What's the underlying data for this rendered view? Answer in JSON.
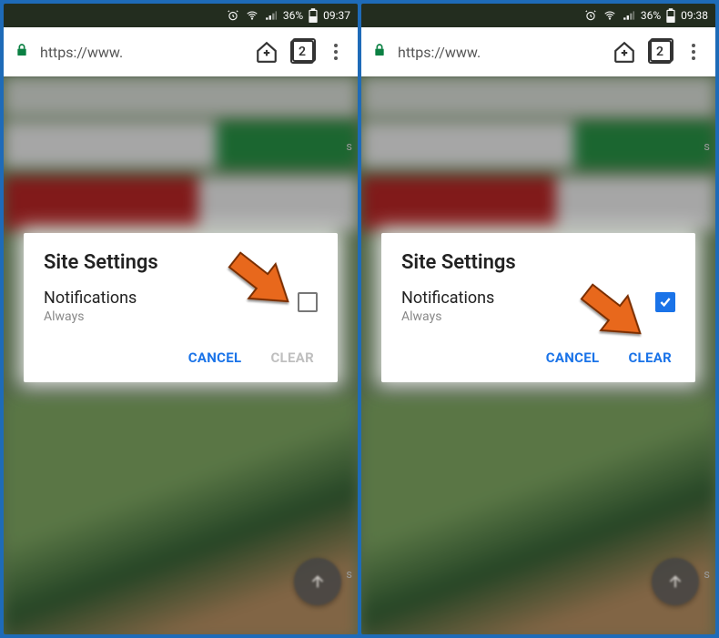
{
  "panels": [
    {
      "status": {
        "battery": "36%",
        "time": "09:37"
      },
      "url": {
        "prefix": "https://www.",
        "blurred": " "
      },
      "tabs": "2",
      "dialog": {
        "title": "Site Settings",
        "notif_label": "Notifications",
        "notif_sub": "Always",
        "checked": false,
        "cancel": "CANCEL",
        "clear": "CLEAR"
      },
      "arrow_target": "checkbox"
    },
    {
      "status": {
        "battery": "36%",
        "time": "09:38"
      },
      "url": {
        "prefix": "https://www.",
        "blurred": " "
      },
      "tabs": "2",
      "dialog": {
        "title": "Site Settings",
        "notif_label": "Notifications",
        "notif_sub": "Always",
        "checked": true,
        "cancel": "CANCEL",
        "clear": "CLEAR"
      },
      "arrow_target": "clear"
    }
  ]
}
